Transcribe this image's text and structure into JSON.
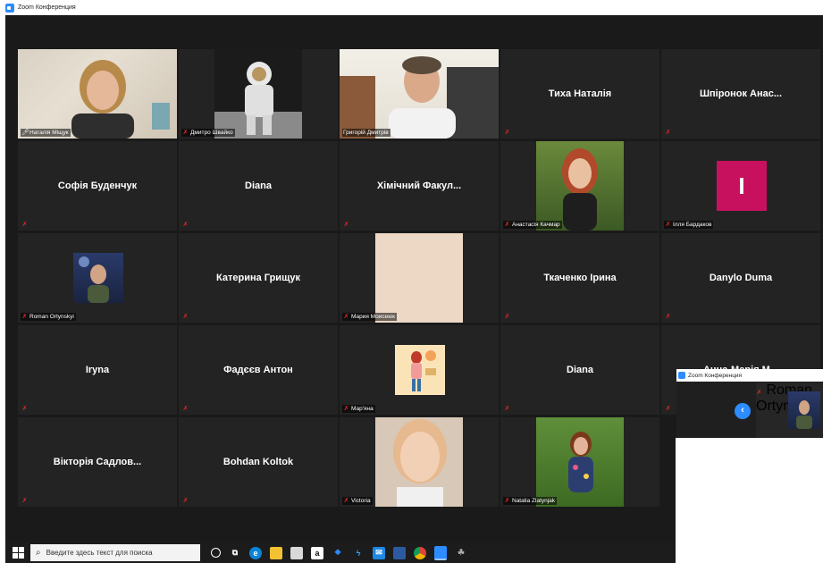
{
  "window": {
    "title": "Zoom Конференция"
  },
  "participants": [
    {
      "name": "Наталія Міщук",
      "mic": "on",
      "active": true
    },
    {
      "name": "Дмитро Швайко",
      "mic": "muted"
    },
    {
      "name": "Григорій Дмитрів",
      "mic": "none"
    },
    {
      "name": "Тиха Наталія",
      "mic": "muted"
    },
    {
      "name": "Шпіронок  Анас...",
      "mic": "muted"
    },
    {
      "name": "Софія Буденчук",
      "mic": "muted"
    },
    {
      "name": "Diana",
      "mic": "muted"
    },
    {
      "name": "Хімічний Факул...",
      "mic": "muted"
    },
    {
      "name": "Анастасія Качмар",
      "mic": "muted"
    },
    {
      "name": "Ілля Бардаков",
      "mic": "muted",
      "initial": "I",
      "initial_color": "#c8115e"
    },
    {
      "name": "Roman Ortynskyi",
      "mic": "muted"
    },
    {
      "name": "Катерина Грищук",
      "mic": "muted"
    },
    {
      "name": "Мария Моисеюк",
      "mic": "muted"
    },
    {
      "name": "Ткаченко Ірина",
      "mic": "muted"
    },
    {
      "name": "Danylo Duma",
      "mic": "muted"
    },
    {
      "name": "Iryna",
      "mic": "muted"
    },
    {
      "name": "Фадєєв Антон",
      "mic": "muted"
    },
    {
      "name": "Мар'яна",
      "mic": "muted"
    },
    {
      "name": "Diana",
      "mic": "muted"
    },
    {
      "name": "Анна-Марія М...",
      "mic": "muted"
    },
    {
      "name": "Вікторія Садлов...",
      "mic": "muted"
    },
    {
      "name": "Bohdan Koltok",
      "mic": "muted"
    },
    {
      "name": "Victoria",
      "mic": "muted"
    },
    {
      "name": "Natalia Zlatynjak",
      "mic": "muted"
    }
  ],
  "taskbar": {
    "search_placeholder": "Введите здесь текст для поиска",
    "icons": [
      "windows-icon",
      "search-icon",
      "cortana-icon",
      "task-view-icon",
      "edge-icon",
      "file-explorer-icon",
      "store-icon",
      "amazon-icon",
      "dropbox-icon",
      "lightning-icon",
      "mail-icon",
      "save-icon",
      "chrome-icon",
      "zoom-icon",
      "paint-icon"
    ]
  },
  "mini_window": {
    "title": "Zoom Конференция",
    "participant": "Roman Ortynskyi"
  },
  "colors": {
    "tile_bg": "#232323",
    "active_border": "#b9d832",
    "zoom_blue": "#2d8cff",
    "mic_muted": "#e02828"
  }
}
